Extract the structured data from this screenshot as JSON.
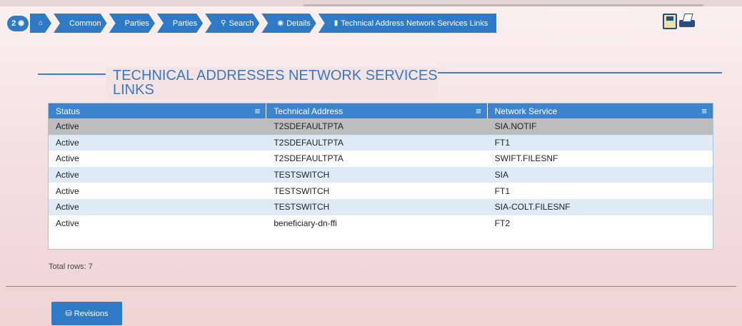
{
  "breadcrumb": {
    "counter": "2",
    "items": [
      {
        "label": "",
        "icon": "home-icon"
      },
      {
        "label": "Common"
      },
      {
        "label": "Parties"
      },
      {
        "label": "Parties"
      },
      {
        "label": "Search",
        "icon": "search-icon"
      },
      {
        "label": "Details",
        "icon": "eye-icon"
      },
      {
        "label": "Technical Address Network Services Links",
        "icon": "bookmark-icon"
      }
    ]
  },
  "page": {
    "title": "TECHNICAL ADDRESSES NETWORK SERVICES LINKS"
  },
  "table": {
    "columns": [
      "Status",
      "Technical Address",
      "Network Service"
    ],
    "rows": [
      [
        "Active",
        "T2SDEFAULTPTA",
        "SIA.NOTIF"
      ],
      [
        "Active",
        "T2SDEFAULTPTA",
        "FT1"
      ],
      [
        "Active",
        "T2SDEFAULTPTA",
        "SWIFT.FILESNF"
      ],
      [
        "Active",
        "TESTSWITCH",
        "SIA"
      ],
      [
        "Active",
        "TESTSWITCH",
        "FT1"
      ],
      [
        "Active",
        "TESTSWITCH",
        "SIA-COLT.FILESNF"
      ],
      [
        "Active",
        "beneficiary-dn-ffi",
        "FT2"
      ]
    ],
    "total": "Total rows: 7"
  },
  "footer": {
    "revisions_label": "Revisions"
  },
  "colors": {
    "accent": "#2f7ac6",
    "header": "#3c84cd",
    "selected_row": "#bdbdbd",
    "alt_row": "#deebf7"
  }
}
